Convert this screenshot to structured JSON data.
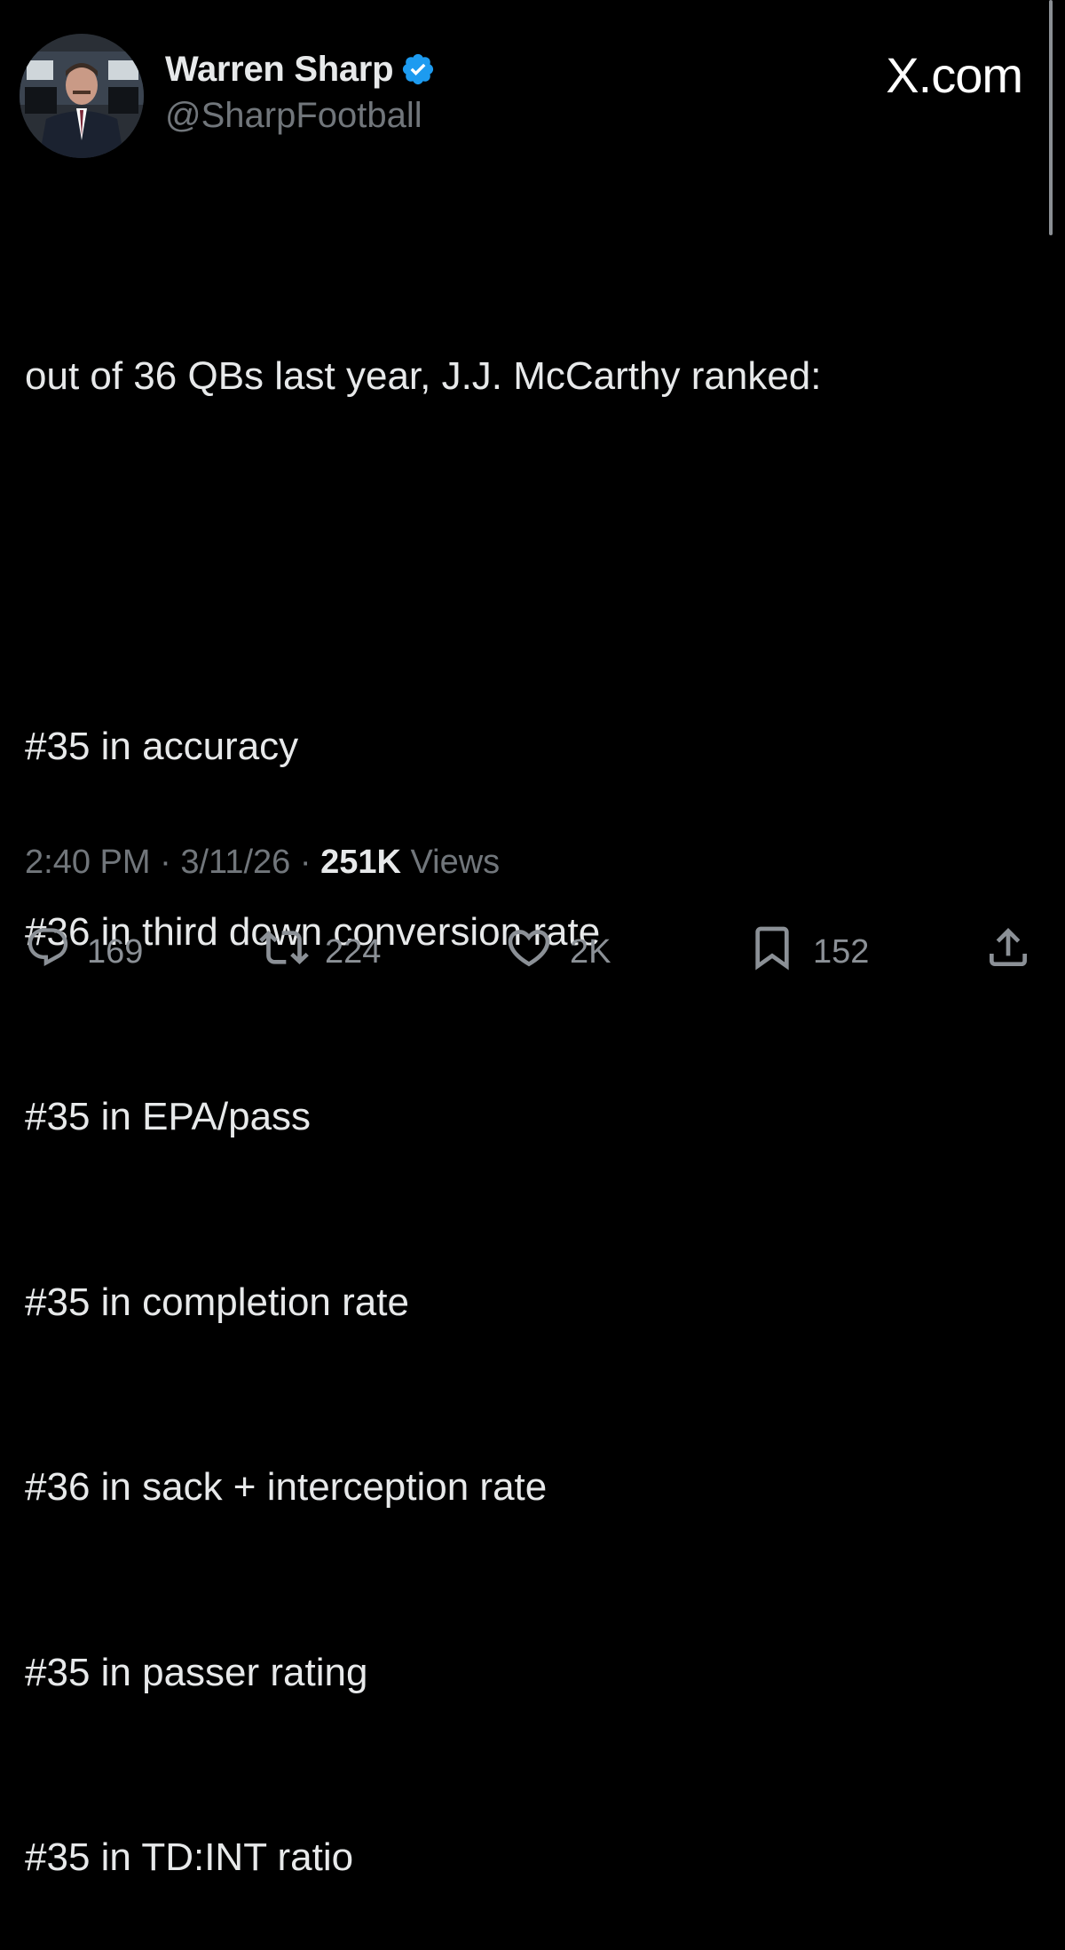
{
  "author": {
    "display_name": "Warren Sharp",
    "handle": "@SharpFootball",
    "verified": true,
    "avatar_icon": "profile-photo"
  },
  "source_label": "X.com",
  "tweet": {
    "intro": "out of 36 QBs last year, J.J. McCarthy ranked:",
    "rankings": [
      "#35 in accuracy",
      "#36 in third down conversion rate",
      "#35 in EPA/pass",
      "#35 in completion rate",
      "#36 in sack + interception rate",
      "#35 in passer rating",
      "#35 in TD:INT ratio"
    ]
  },
  "meta": {
    "time": "2:40 PM",
    "separator": " · ",
    "date": "3/11/26",
    "views_count": "251K",
    "views_label": " Views"
  },
  "actions": {
    "replies": {
      "count": "169",
      "icon": "reply-icon"
    },
    "reposts": {
      "count": "224",
      "icon": "repost-icon"
    },
    "likes": {
      "count": "2K",
      "icon": "heart-icon"
    },
    "bookmarks": {
      "count": "152",
      "icon": "bookmark-icon"
    },
    "share": {
      "icon": "share-icon"
    }
  },
  "colors": {
    "background": "#000000",
    "primary_text": "#e7e9ea",
    "secondary_text": "#71767b",
    "verified_badge": "#1d9bf0"
  }
}
